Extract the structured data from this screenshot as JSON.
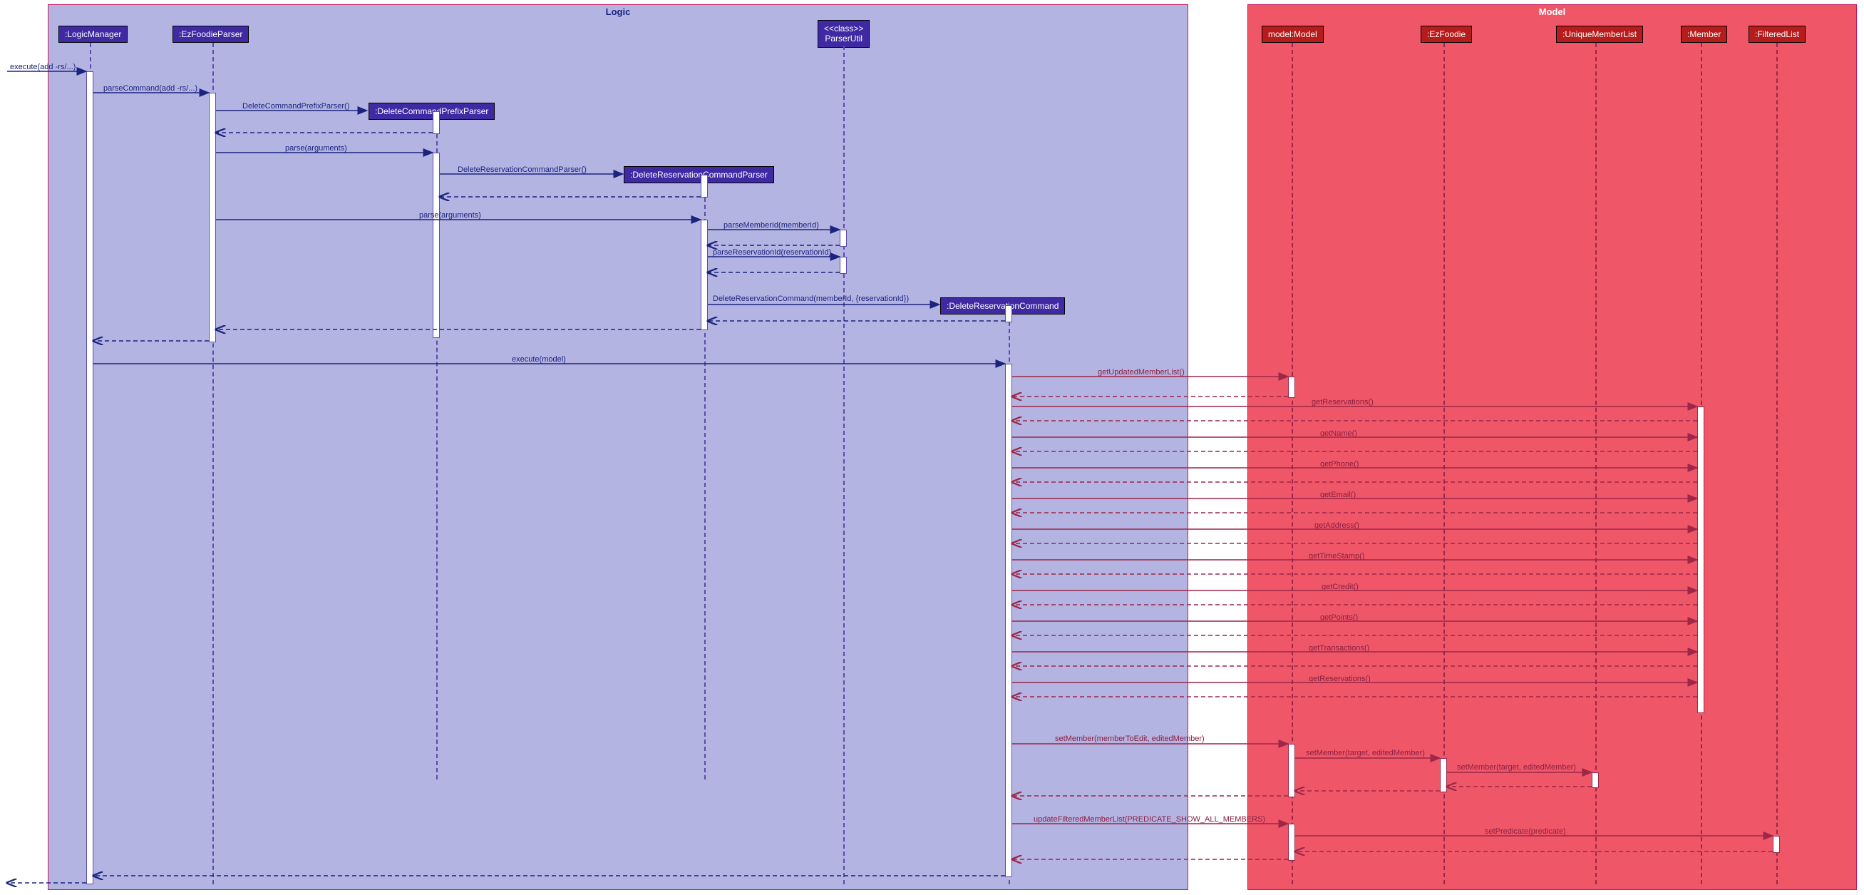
{
  "frames": {
    "logic": {
      "title": "Logic"
    },
    "model": {
      "title": "Model"
    }
  },
  "participants": {
    "logicManager": ":LogicManager",
    "ezFoodieParser": ":EzFoodieParser",
    "parserUtilStereo": "<<class>>",
    "parserUtil": "ParserUtil",
    "deleteCmdPrefixParser": ":DeleteCommandPrefixParser",
    "deleteResCmdParser": ":DeleteReservationCommandParser",
    "deleteResCmd": ":DeleteReservationCommand",
    "modelModel": "model:Model",
    "ezFoodie": ":EzFoodie",
    "uniqueMemberList": ":UniqueMemberList",
    "member": ":Member",
    "filteredList": ":FilteredList"
  },
  "messages": {
    "execute1": "execute(add -rs/...)",
    "parseCommand": "parseCommand(add -rs/...)",
    "deleteCmdPrefixParserCall": "DeleteCommandPrefixParser()",
    "parseArgs1": "parse(arguments)",
    "deleteResCmdParserCall": "DeleteReservationCommandParser()",
    "parseArgs2": "parse(arguments)",
    "parseMemberId": "parseMemberId(memberId)",
    "parseReservationId": "parseReservationId(reservationId)",
    "deleteResCmdCall": "DeleteReservationCommand(memberId, {reservationId})",
    "executeModel": "execute(model)",
    "getUpdatedMemberList": "getUpdatedMemberList()",
    "getReservations1": "getReservations()",
    "getName": "getName()",
    "getPhone": "getPhone()",
    "getEmail": "getEmail()",
    "getAddress": "getAddress()",
    "getTimeStamp": "getTimeStamp()",
    "getCredit": "getCredit()",
    "getPoints": "getPoints()",
    "getTransactions": "getTransactions()",
    "getReservations2": "getReservations()",
    "setMember1": "setMember(memberToEdit, editedMember)",
    "setMember2": "setMember(target, editedMember)",
    "setMember3": "setMember(target, editedMember)",
    "updateFilteredMemberList": "updateFilteredMemberList(PREDICATE_SHOW_ALL_MEMBERS)",
    "setPredicate": "setPredicate(predicate)"
  }
}
